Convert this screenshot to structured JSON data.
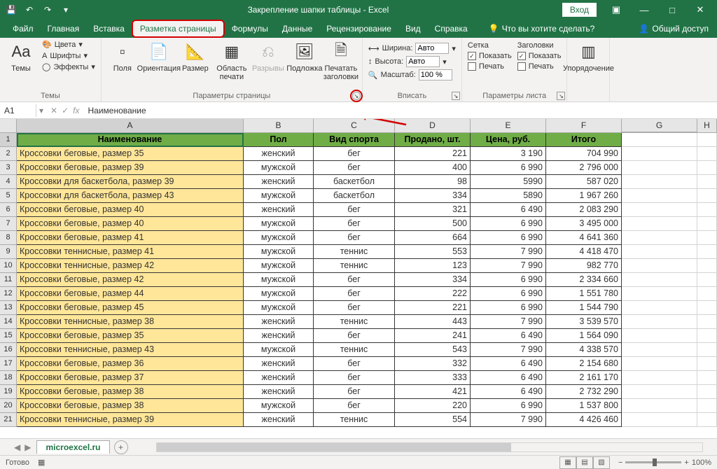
{
  "titlebar": {
    "title": "Закрепление шапки таблицы  -  Excel",
    "login": "Вход"
  },
  "tabs": {
    "file": "Файл",
    "home": "Главная",
    "insert": "Вставка",
    "layout": "Разметка страницы",
    "formulas": "Формулы",
    "data": "Данные",
    "review": "Рецензирование",
    "view": "Вид",
    "help": "Справка",
    "tellme": "Что вы хотите сделать?",
    "share": "Общий доступ"
  },
  "ribbon": {
    "themes": {
      "themes": "Темы",
      "colors": "Цвета",
      "fonts": "Шрифты",
      "effects": "Эффекты",
      "group": "Темы"
    },
    "page": {
      "margins": "Поля",
      "orient": "Ориентация",
      "size": "Размер",
      "area": "Область печати",
      "breaks": "Разрывы",
      "bg": "Подложка",
      "titles": "Печатать заголовки",
      "group": "Параметры страницы"
    },
    "fit": {
      "width": "Ширина:",
      "height": "Высота:",
      "scale": "Масштаб:",
      "auto": "Авто",
      "scale_val": "100 %",
      "group": "Вписать"
    },
    "sheet": {
      "grid": "Сетка",
      "head": "Заголовки",
      "show": "Показать",
      "print": "Печать",
      "group": "Параметры листа"
    },
    "arrange": {
      "arrange": "Упорядочение"
    }
  },
  "namebox": "A1",
  "formula": "Наименование",
  "columns": [
    "A",
    "B",
    "C",
    "D",
    "E",
    "F",
    "G",
    "H"
  ],
  "headers": [
    "Наименование",
    "Пол",
    "Вид спорта",
    "Продано, шт.",
    "Цена, руб.",
    "Итого"
  ],
  "rows": [
    [
      "Кроссовки беговые, размер 35",
      "женский",
      "бег",
      "221",
      "3 190",
      "704 990"
    ],
    [
      "Кроссовки беговые, размер 39",
      "мужской",
      "бег",
      "400",
      "6 990",
      "2 796 000"
    ],
    [
      "Кроссовки для баскетбола, размер 39",
      "женский",
      "баскетбол",
      "98",
      "5990",
      "587 020"
    ],
    [
      "Кроссовки для баскетбола, размер 43",
      "мужской",
      "баскетбол",
      "334",
      "5890",
      "1 967 260"
    ],
    [
      "Кроссовки беговые, размер 40",
      "женский",
      "бег",
      "321",
      "6 490",
      "2 083 290"
    ],
    [
      "Кроссовки беговые, размер 40",
      "мужской",
      "бег",
      "500",
      "6 990",
      "3 495 000"
    ],
    [
      "Кроссовки беговые, размер 41",
      "мужской",
      "бег",
      "664",
      "6 990",
      "4 641 360"
    ],
    [
      "Кроссовки теннисные, размер 41",
      "мужской",
      "теннис",
      "553",
      "7 990",
      "4 418 470"
    ],
    [
      "Кроссовки теннисные, размер 42",
      "мужской",
      "теннис",
      "123",
      "7 990",
      "982 770"
    ],
    [
      "Кроссовки беговые, размер 42",
      "мужской",
      "бег",
      "334",
      "6 990",
      "2 334 660"
    ],
    [
      "Кроссовки беговые, размер 44",
      "мужской",
      "бег",
      "222",
      "6 990",
      "1 551 780"
    ],
    [
      "Кроссовки беговые, размер 45",
      "мужской",
      "бег",
      "221",
      "6 990",
      "1 544 790"
    ],
    [
      "Кроссовки теннисные, размер 38",
      "женский",
      "теннис",
      "443",
      "7 990",
      "3 539 570"
    ],
    [
      "Кроссовки беговые, размер 35",
      "женский",
      "бег",
      "241",
      "6 490",
      "1 564 090"
    ],
    [
      "Кроссовки теннисные, размер 43",
      "мужской",
      "теннис",
      "543",
      "7 990",
      "4 338 570"
    ],
    [
      "Кроссовки беговые, размер 36",
      "женский",
      "бег",
      "332",
      "6 490",
      "2 154 680"
    ],
    [
      "Кроссовки беговые, размер 37",
      "женский",
      "бег",
      "333",
      "6 490",
      "2 161 170"
    ],
    [
      "Кроссовки беговые, размер 38",
      "женский",
      "бег",
      "421",
      "6 490",
      "2 732 290"
    ],
    [
      "Кроссовки беговые, размер 38",
      "мужской",
      "бег",
      "220",
      "6 990",
      "1 537 800"
    ],
    [
      "Кроссовки теннисные, размер 39",
      "женский",
      "теннис",
      "554",
      "7 990",
      "4 426 460"
    ]
  ],
  "sheet": {
    "name": "microexcel.ru"
  },
  "status": {
    "ready": "Готово",
    "zoom": "100%"
  }
}
